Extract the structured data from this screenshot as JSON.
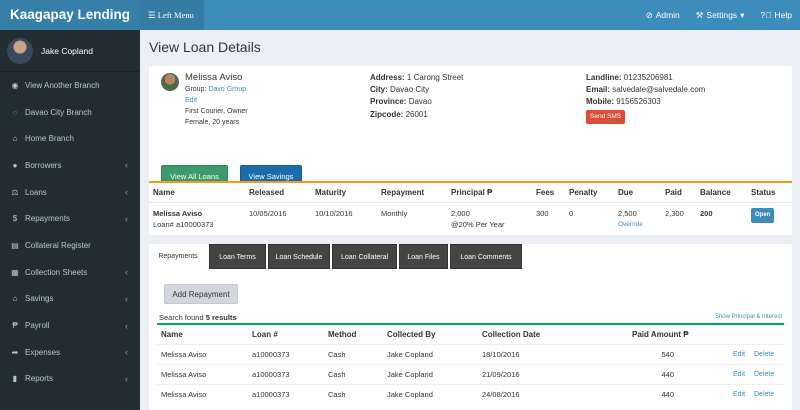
{
  "app": {
    "brand": "Kaagapay Lending",
    "left_menu": "Left Menu",
    "nav": [
      {
        "icon": "gauge-icon",
        "label": "Admin"
      },
      {
        "icon": "wrench-icon",
        "label": "Settings"
      },
      {
        "icon": "help-icon",
        "label": "Help"
      }
    ]
  },
  "sidebar": {
    "user_name": "Jake Copland",
    "items": [
      {
        "icon": "eye-icon",
        "label": "View Another Branch",
        "chevron": false
      },
      {
        "icon": "circle-icon",
        "label": "Davao City Branch",
        "chevron": false
      },
      {
        "icon": "home-icon",
        "label": "Home Branch",
        "chevron": false
      },
      {
        "icon": "user-icon",
        "label": "Borrowers",
        "chevron": true
      },
      {
        "icon": "balance-icon",
        "label": "Loans",
        "chevron": true
      },
      {
        "icon": "dollar-icon",
        "label": "Repayments",
        "chevron": true
      },
      {
        "icon": "list-icon",
        "label": "Collateral Register",
        "chevron": false
      },
      {
        "icon": "table-icon",
        "label": "Collection Sheets",
        "chevron": true
      },
      {
        "icon": "bank-icon",
        "label": "Savings",
        "chevron": true
      },
      {
        "icon": "paper-icon",
        "label": "Payroll",
        "chevron": true
      },
      {
        "icon": "share-icon",
        "label": "Expenses",
        "chevron": true
      },
      {
        "icon": "chart-icon",
        "label": "Reports",
        "chevron": true
      }
    ]
  },
  "page": {
    "title": "View Loan Details"
  },
  "client": {
    "name": "Melissa Aviso",
    "group_label": "Group:",
    "group_value": "Davo Group",
    "edit_label": "Edit",
    "occupation": "First Courier, Owner",
    "gender_age": "Female, 20 years",
    "address_label": "Address:",
    "address": "1 Carong Street",
    "city_label": "City:",
    "city": "Davao City",
    "province_label": "Province:",
    "province": "Davao",
    "zipcode_label": "Zipcode:",
    "zipcode": "26001",
    "landline_label": "Landline:",
    "landline": "01235206981",
    "email_label": "Email:",
    "email": "salvedale@salvedale.com",
    "mobile_label": "Mobile:",
    "mobile": "9156526303",
    "send_sms": "Send SMS",
    "view_loans_btn": "View All Loans",
    "view_savings_btn": "View Savings"
  },
  "loan": {
    "headers": [
      "Name",
      "Released",
      "Maturity",
      "Repayment",
      "Principal ₱",
      "Fees",
      "Penalty",
      "Due",
      "Paid",
      "Balance",
      "Status"
    ],
    "name": "Melissa Aviso",
    "loan_no": "Loan# a10000373",
    "released": "10/05/2016",
    "maturity": "10/10/2016",
    "repayment": "Monthly",
    "principal": "2,000",
    "interest": "@20% Per Year",
    "fees": "300",
    "penalty": "0",
    "due": "2,500",
    "override": "Override",
    "paid": "2,300",
    "balance": "200",
    "status": "Open"
  },
  "tabs": [
    "Repayments",
    "Loan Terms",
    "Loan Schedule",
    "Loan Collateral",
    "Loan Files",
    "Loan Comments"
  ],
  "repayments": {
    "add_btn": "Add Repayment",
    "search_prefix": "Search found",
    "search_count": "5 results",
    "show_pi": "Show Principal & Interest",
    "headers": [
      "Name",
      "Loan #",
      "Method",
      "Collected By",
      "Collection Date",
      "Paid Amount ₱"
    ],
    "edit_label": "Edit",
    "delete_label": "Delete",
    "rows": [
      {
        "name": "Melissa Aviso",
        "loan": "a10000373",
        "method": "Cash",
        "collected_by": "Jake Copland",
        "date": "18/10/2016",
        "amount": "540"
      },
      {
        "name": "Melissa Aviso",
        "loan": "a10000373",
        "method": "Cash",
        "collected_by": "Jake Copland",
        "date": "21/09/2016",
        "amount": "440"
      },
      {
        "name": "Melissa Aviso",
        "loan": "a10000373",
        "method": "Cash",
        "collected_by": "Jake Copland",
        "date": "24/08/2016",
        "amount": "440"
      }
    ]
  }
}
